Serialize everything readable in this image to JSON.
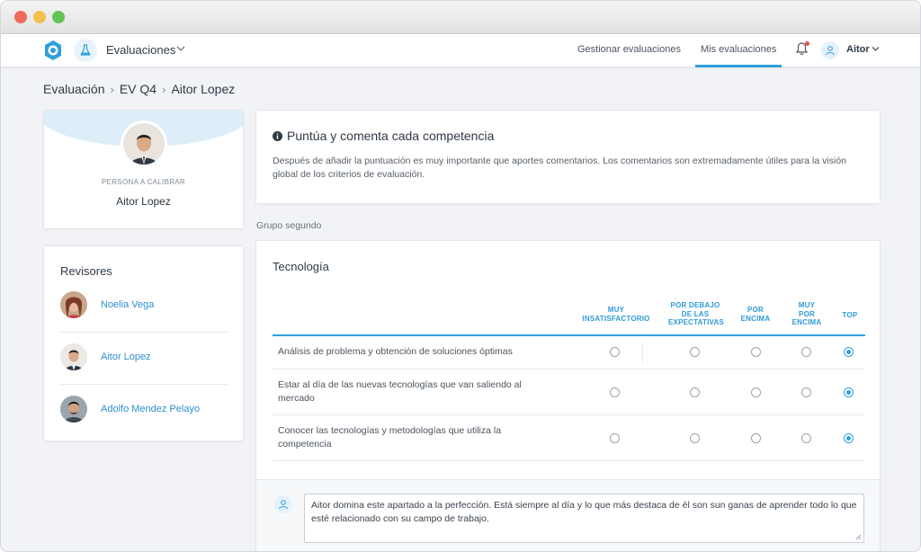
{
  "nav": {
    "app_title": "Evaluaciones",
    "links": [
      "Gestionar evaluaciones",
      "Mis evaluaciones"
    ],
    "active_link": "Mis evaluaciones",
    "user": "Aitor",
    "accent": "#2ea0dc"
  },
  "breadcrumb": [
    "Evaluación",
    "EV Q4",
    "Aitor Lopez"
  ],
  "person": {
    "role": "PERSONA A CALIBRAR",
    "name": "Aitor Lopez"
  },
  "reviewers": {
    "title": "Revisores",
    "items": [
      "Noelia Vega",
      "Aitor Lopez",
      "Adolfo Mendez Pelayo"
    ]
  },
  "info": {
    "title": "Puntúa y comenta cada competencia",
    "text": "Después de añadir la puntuación es muy importante que aportes comentarios. Los comentarios son extremadamente útiles para la visión global de los criterios de evaluación.",
    "icon": "info-circle-icon"
  },
  "group_label": "Grupo segundo",
  "section": {
    "title": "Tecnología",
    "columns": [
      "MUY INSATISFACTORIO",
      "POR DEBAJO DE LAS EXPECTATIVAS",
      "POR ENCIMA",
      "MUY POR ENCIMA",
      "TOP"
    ],
    "rows": [
      {
        "label": "Análisis de problema y obtención de soluciones óptimas",
        "selected": "TOP"
      },
      {
        "label": "Estar al día de las nuevas tecnologías que van saliendo al mercado",
        "selected": "TOP"
      },
      {
        "label": "Conocer las tecnologías y metodologías que utiliza la competencia",
        "selected": "TOP"
      }
    ]
  },
  "comment": {
    "value": "Aitor domina este apartado a la perfección. Está siempre al día y lo que más destaca de él son sun ganas de aprender todo lo que esté relacionado con su campo de trabajo."
  }
}
